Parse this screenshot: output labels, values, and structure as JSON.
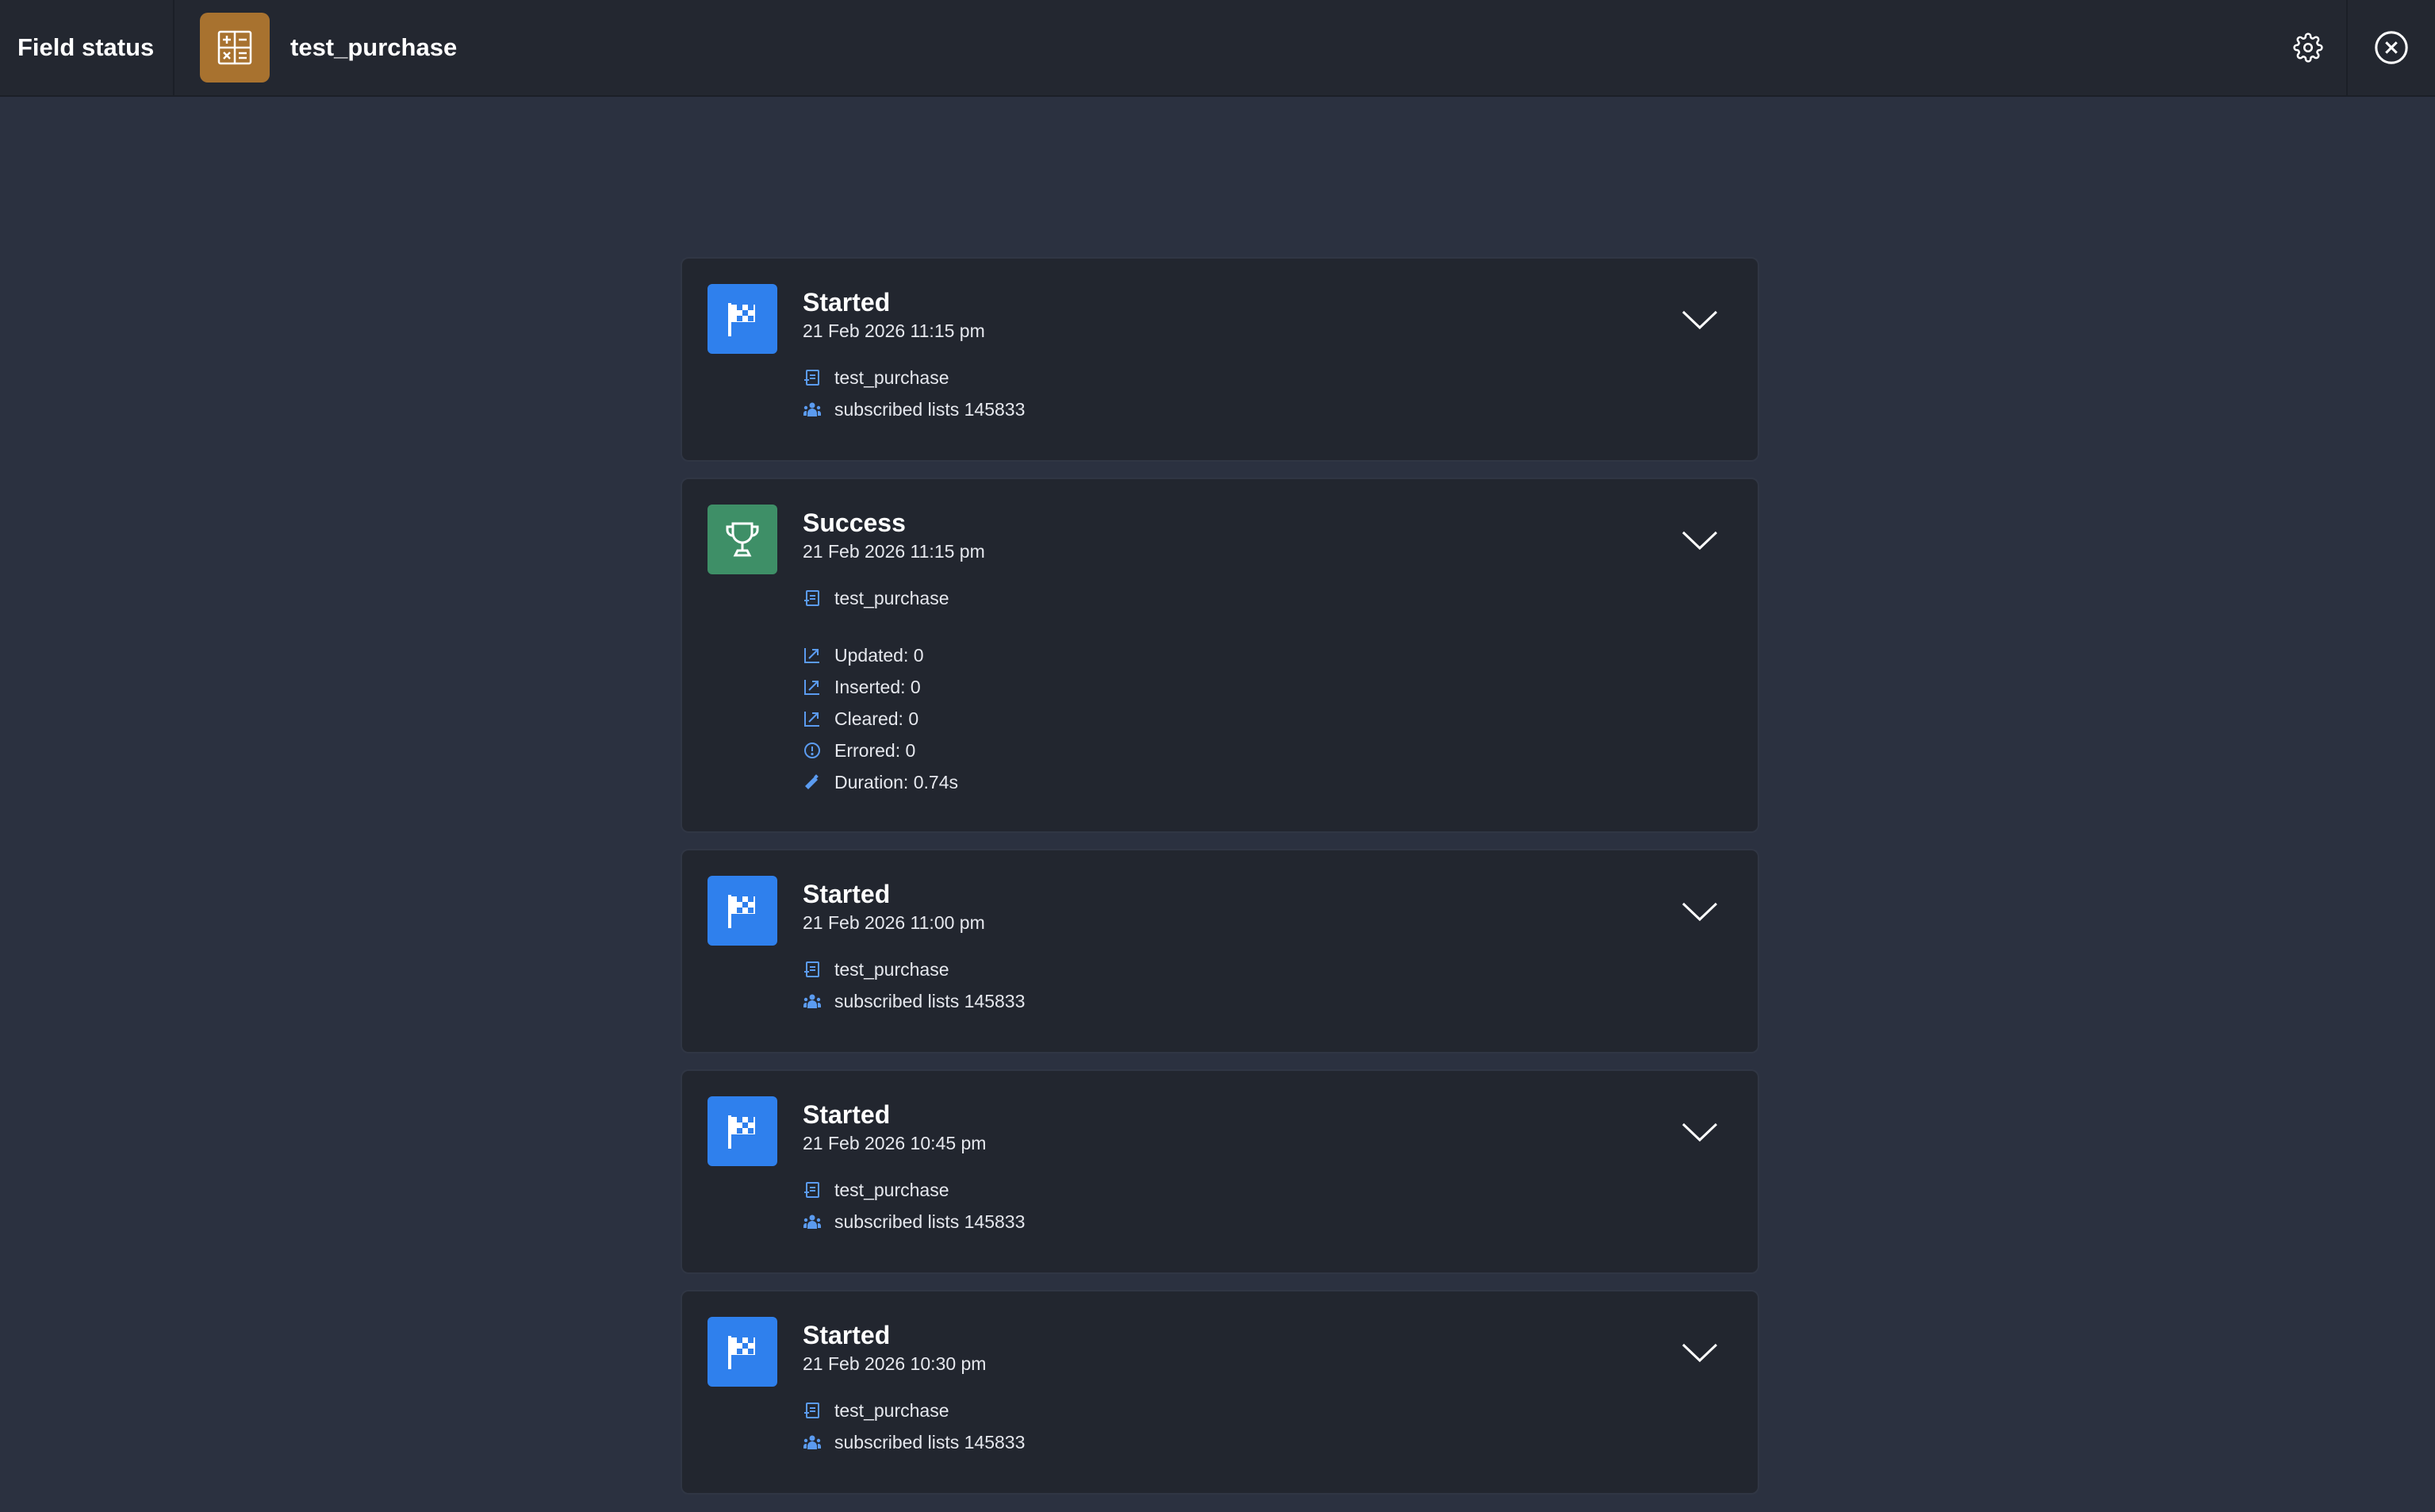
{
  "header": {
    "title": "Field status",
    "source_name": "test_purchase",
    "source_icon": "table-icon",
    "source_color": "#a8722f"
  },
  "events": [
    {
      "status": "Started",
      "timestamp": "21 Feb 2026 11:15 pm",
      "kind": "started",
      "source": "test_purchase",
      "audience": "subscribed lists 145833"
    },
    {
      "status": "Success",
      "timestamp": "21 Feb 2026 11:15 pm",
      "kind": "success",
      "source": "test_purchase",
      "stats": {
        "updated": "Updated: 0",
        "inserted": "Inserted: 0",
        "cleared": "Cleared: 0",
        "errored": "Errored: 0",
        "duration": "Duration: 0.74s"
      }
    },
    {
      "status": "Started",
      "timestamp": "21 Feb 2026 11:00 pm",
      "kind": "started",
      "source": "test_purchase",
      "audience": "subscribed lists 145833"
    },
    {
      "status": "Started",
      "timestamp": "21 Feb 2026 10:45 pm",
      "kind": "started",
      "source": "test_purchase",
      "audience": "subscribed lists 145833"
    },
    {
      "status": "Started",
      "timestamp": "21 Feb 2026 10:30 pm",
      "kind": "started",
      "source": "test_purchase",
      "audience": "subscribed lists 145833"
    }
  ],
  "colors": {
    "started": "#2f80ed",
    "success": "#3e8f67",
    "accent_icon": "#5b9bf0"
  }
}
